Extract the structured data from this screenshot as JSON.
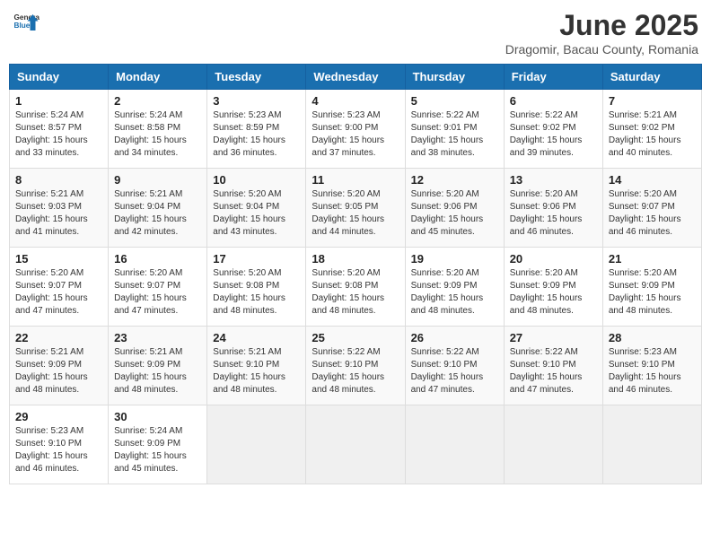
{
  "app": {
    "logo_general": "General",
    "logo_blue": "Blue",
    "title": "June 2025",
    "subtitle": "Dragomir, Bacau County, Romania"
  },
  "calendar": {
    "headers": [
      "Sunday",
      "Monday",
      "Tuesday",
      "Wednesday",
      "Thursday",
      "Friday",
      "Saturday"
    ],
    "weeks": [
      [
        {
          "day": "",
          "empty": true
        },
        {
          "day": "",
          "empty": true
        },
        {
          "day": "",
          "empty": true
        },
        {
          "day": "",
          "empty": true
        },
        {
          "day": "",
          "empty": true
        },
        {
          "day": "",
          "empty": true
        },
        {
          "day": "",
          "empty": true
        }
      ],
      [
        {
          "day": "1",
          "sunrise": "5:24 AM",
          "sunset": "8:57 PM",
          "daylight": "15 hours and 33 minutes."
        },
        {
          "day": "2",
          "sunrise": "5:24 AM",
          "sunset": "8:58 PM",
          "daylight": "15 hours and 34 minutes."
        },
        {
          "day": "3",
          "sunrise": "5:23 AM",
          "sunset": "8:59 PM",
          "daylight": "15 hours and 36 minutes."
        },
        {
          "day": "4",
          "sunrise": "5:23 AM",
          "sunset": "9:00 PM",
          "daylight": "15 hours and 37 minutes."
        },
        {
          "day": "5",
          "sunrise": "5:22 AM",
          "sunset": "9:01 PM",
          "daylight": "15 hours and 38 minutes."
        },
        {
          "day": "6",
          "sunrise": "5:22 AM",
          "sunset": "9:02 PM",
          "daylight": "15 hours and 39 minutes."
        },
        {
          "day": "7",
          "sunrise": "5:21 AM",
          "sunset": "9:02 PM",
          "daylight": "15 hours and 40 minutes."
        }
      ],
      [
        {
          "day": "8",
          "sunrise": "5:21 AM",
          "sunset": "9:03 PM",
          "daylight": "15 hours and 41 minutes."
        },
        {
          "day": "9",
          "sunrise": "5:21 AM",
          "sunset": "9:04 PM",
          "daylight": "15 hours and 42 minutes."
        },
        {
          "day": "10",
          "sunrise": "5:20 AM",
          "sunset": "9:04 PM",
          "daylight": "15 hours and 43 minutes."
        },
        {
          "day": "11",
          "sunrise": "5:20 AM",
          "sunset": "9:05 PM",
          "daylight": "15 hours and 44 minutes."
        },
        {
          "day": "12",
          "sunrise": "5:20 AM",
          "sunset": "9:06 PM",
          "daylight": "15 hours and 45 minutes."
        },
        {
          "day": "13",
          "sunrise": "5:20 AM",
          "sunset": "9:06 PM",
          "daylight": "15 hours and 46 minutes."
        },
        {
          "day": "14",
          "sunrise": "5:20 AM",
          "sunset": "9:07 PM",
          "daylight": "15 hours and 46 minutes."
        }
      ],
      [
        {
          "day": "15",
          "sunrise": "5:20 AM",
          "sunset": "9:07 PM",
          "daylight": "15 hours and 47 minutes."
        },
        {
          "day": "16",
          "sunrise": "5:20 AM",
          "sunset": "9:07 PM",
          "daylight": "15 hours and 47 minutes."
        },
        {
          "day": "17",
          "sunrise": "5:20 AM",
          "sunset": "9:08 PM",
          "daylight": "15 hours and 48 minutes."
        },
        {
          "day": "18",
          "sunrise": "5:20 AM",
          "sunset": "9:08 PM",
          "daylight": "15 hours and 48 minutes."
        },
        {
          "day": "19",
          "sunrise": "5:20 AM",
          "sunset": "9:09 PM",
          "daylight": "15 hours and 48 minutes."
        },
        {
          "day": "20",
          "sunrise": "5:20 AM",
          "sunset": "9:09 PM",
          "daylight": "15 hours and 48 minutes."
        },
        {
          "day": "21",
          "sunrise": "5:20 AM",
          "sunset": "9:09 PM",
          "daylight": "15 hours and 48 minutes."
        }
      ],
      [
        {
          "day": "22",
          "sunrise": "5:21 AM",
          "sunset": "9:09 PM",
          "daylight": "15 hours and 48 minutes."
        },
        {
          "day": "23",
          "sunrise": "5:21 AM",
          "sunset": "9:09 PM",
          "daylight": "15 hours and 48 minutes."
        },
        {
          "day": "24",
          "sunrise": "5:21 AM",
          "sunset": "9:10 PM",
          "daylight": "15 hours and 48 minutes."
        },
        {
          "day": "25",
          "sunrise": "5:22 AM",
          "sunset": "9:10 PM",
          "daylight": "15 hours and 48 minutes."
        },
        {
          "day": "26",
          "sunrise": "5:22 AM",
          "sunset": "9:10 PM",
          "daylight": "15 hours and 47 minutes."
        },
        {
          "day": "27",
          "sunrise": "5:22 AM",
          "sunset": "9:10 PM",
          "daylight": "15 hours and 47 minutes."
        },
        {
          "day": "28",
          "sunrise": "5:23 AM",
          "sunset": "9:10 PM",
          "daylight": "15 hours and 46 minutes."
        }
      ],
      [
        {
          "day": "29",
          "sunrise": "5:23 AM",
          "sunset": "9:10 PM",
          "daylight": "15 hours and 46 minutes."
        },
        {
          "day": "30",
          "sunrise": "5:24 AM",
          "sunset": "9:09 PM",
          "daylight": "15 hours and 45 minutes."
        },
        {
          "day": "",
          "empty": true
        },
        {
          "day": "",
          "empty": true
        },
        {
          "day": "",
          "empty": true
        },
        {
          "day": "",
          "empty": true
        },
        {
          "day": "",
          "empty": true
        }
      ]
    ]
  }
}
